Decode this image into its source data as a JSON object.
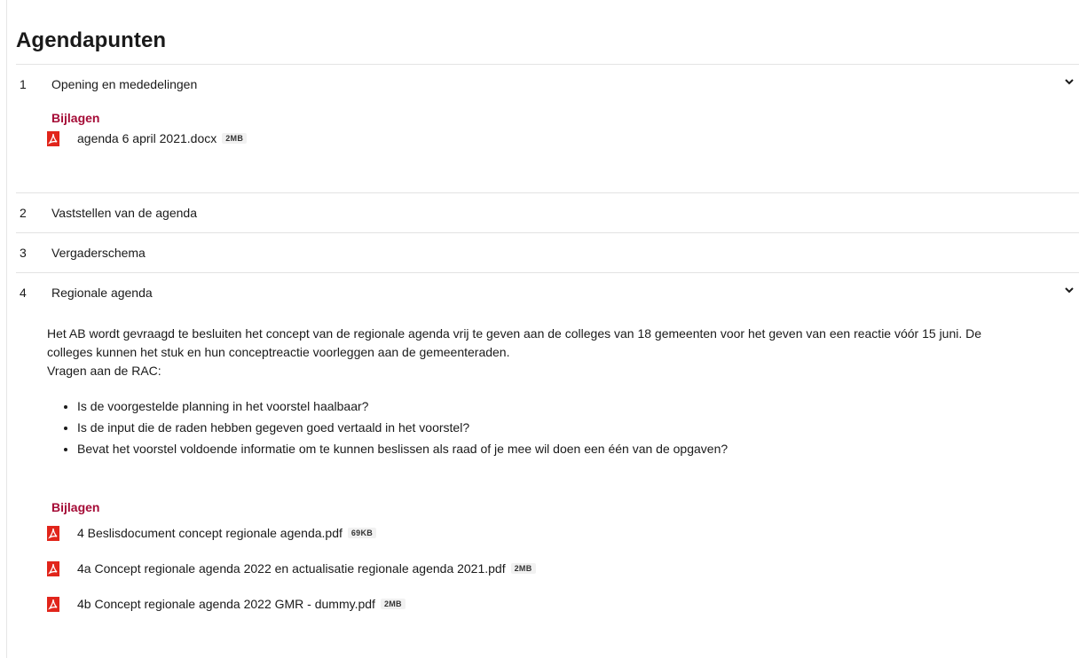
{
  "page_title": "Agendapunten",
  "accent_color": "#a50b36",
  "items": [
    {
      "number": "1",
      "title": "Opening en mededelingen",
      "expanded": true,
      "attachments_label": "Bijlagen",
      "attachments": [
        {
          "name": "agenda 6 april 2021.docx",
          "size": "2MB",
          "icon": "pdf-icon"
        }
      ]
    },
    {
      "number": "2",
      "title": "Vaststellen van de agenda",
      "expanded": false
    },
    {
      "number": "3",
      "title": "Vergaderschema",
      "expanded": false
    },
    {
      "number": "4",
      "title": "Regionale agenda",
      "expanded": true,
      "description_lines": [
        "Het AB wordt gevraagd te besluiten het concept van de regionale agenda vrij te geven aan de colleges van 18 gemeenten voor het geven van een reactie vóór 15 juni. De",
        "colleges kunnen het stuk en hun conceptreactie voorleggen aan de gemeenteraden.",
        "Vragen aan de RAC:"
      ],
      "bullets": [
        "Is de voorgestelde planning in het voorstel haalbaar?",
        "Is de input die de raden hebben gegeven goed vertaald in het voorstel?",
        "Bevat het voorstel voldoende informatie om te kunnen beslissen als raad of je mee wil doen een één van de opgaven?"
      ],
      "attachments_label": "Bijlagen",
      "attachments": [
        {
          "name": "4 Beslisdocument concept regionale agenda.pdf",
          "size": "69KB",
          "icon": "pdf-icon"
        },
        {
          "name": "4a Concept regionale agenda 2022 en actualisatie regionale agenda 2021.pdf",
          "size": "2MB",
          "icon": "pdf-icon"
        },
        {
          "name": "4b Concept regionale agenda 2022 GMR - dummy.pdf",
          "size": "2MB",
          "icon": "pdf-icon"
        }
      ]
    }
  ]
}
